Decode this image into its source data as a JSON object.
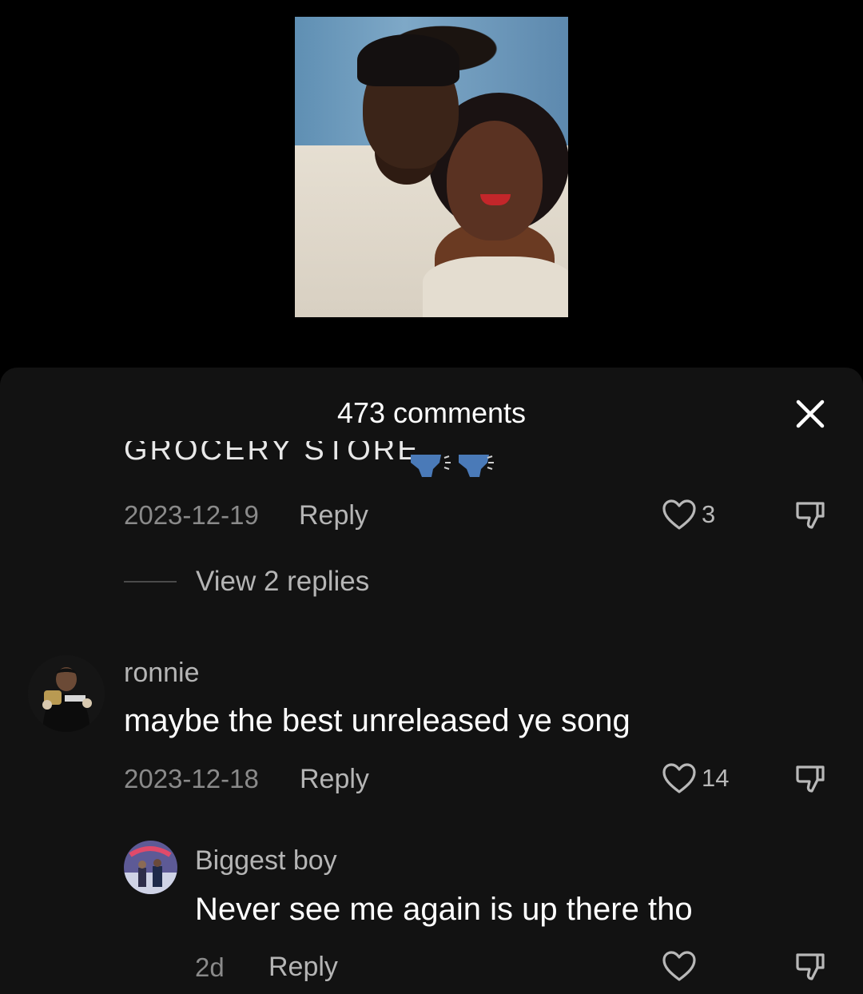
{
  "sheet": {
    "title": "473 comments"
  },
  "comments": [
    {
      "text_fragment": "GROCERY STORE",
      "date": "2023-12-19",
      "reply_label": "Reply",
      "likes": "3",
      "view_replies": "View 2 replies"
    },
    {
      "username": "ronnie",
      "text": "maybe the best unreleased ye song",
      "date": "2023-12-18",
      "reply_label": "Reply",
      "likes": "14"
    },
    {
      "username": "Biggest boy",
      "text": "Never see me again is up there tho",
      "date": "2d",
      "reply_label": "Reply",
      "likes": ""
    }
  ],
  "colors": {
    "background": "#000000",
    "sheet": "#121212",
    "muted_text": "#8a8a8a",
    "secondary_text": "#b5b5b5"
  }
}
